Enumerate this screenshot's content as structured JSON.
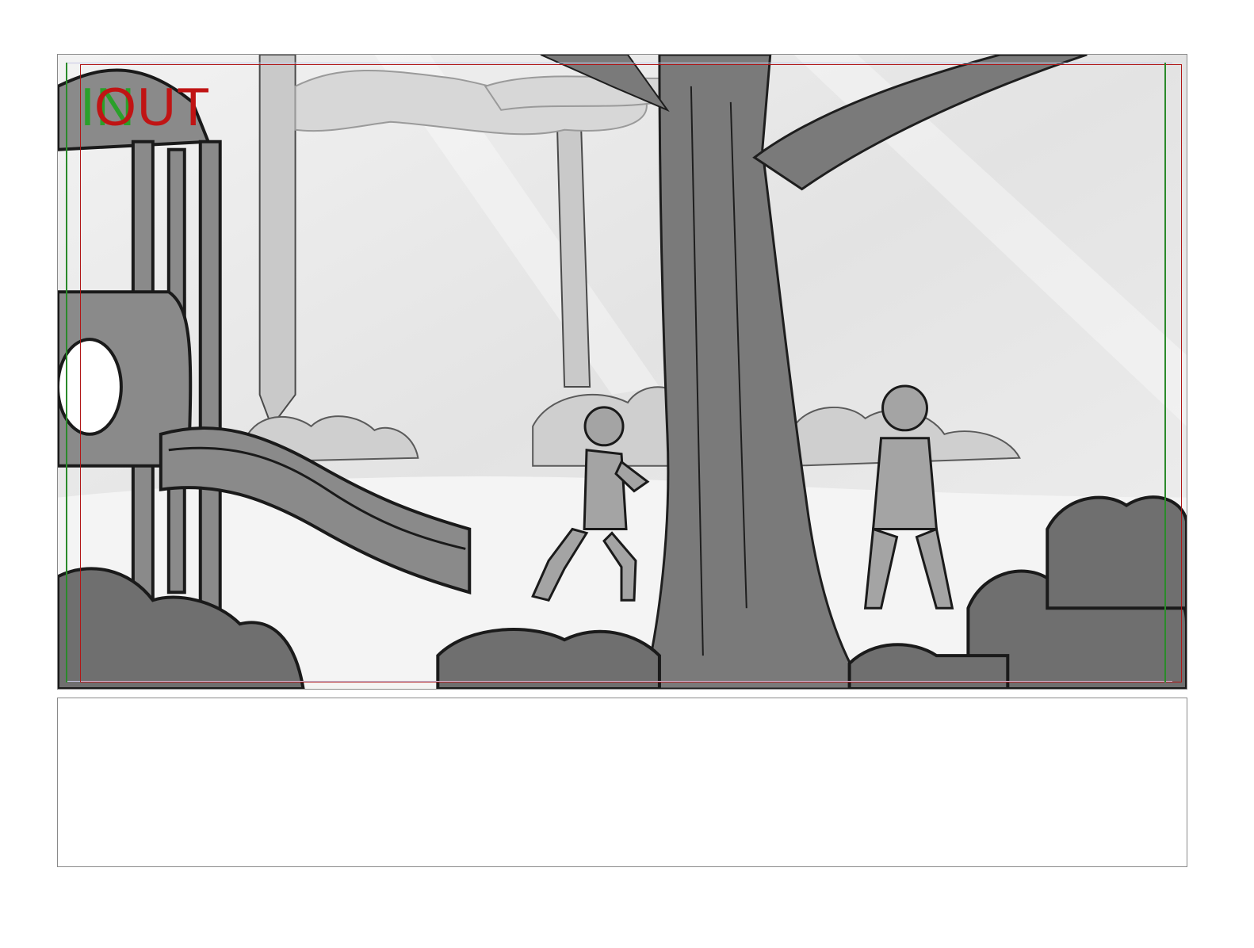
{
  "board": {
    "in_marker": "IN",
    "out_marker": "OUT",
    "colors": {
      "in_marker": "#2aa02a",
      "out_marker": "#c01414",
      "frame_border": "#8a8a8a",
      "sketch_dark": "#6f6f6f",
      "sketch_mid": "#b9b9b9",
      "sketch_light": "#e6e6e6"
    }
  },
  "notes": {
    "text": ""
  }
}
